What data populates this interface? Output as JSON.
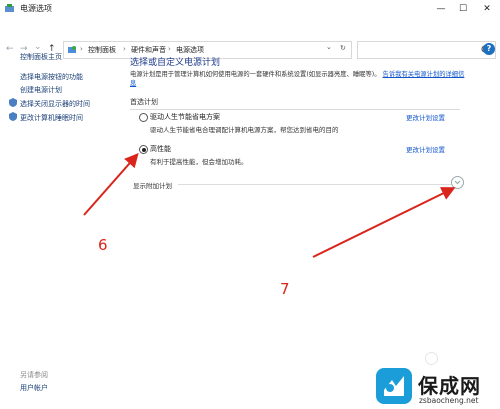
{
  "window": {
    "title": "电源选项",
    "minimize_glyph": "—",
    "maximize_glyph": "☐",
    "close_glyph": "✕"
  },
  "nav": {
    "back": "←",
    "forward": "→",
    "down": "⌄",
    "up": "↑"
  },
  "address": {
    "crumbs": [
      "控制面板",
      "硬件和声音",
      "电源选项"
    ],
    "separator": "›",
    "dropdown": "⌄",
    "refresh": "↻"
  },
  "search": {
    "placeholder": ""
  },
  "help": {
    "label": "?"
  },
  "sidebar": {
    "home": "控制面板主页",
    "links": [
      "选择电源按钮的功能",
      "创建电源计划",
      "选择关闭显示器的时间",
      "更改计算机睡眠时间"
    ],
    "see_also": "另请参阅",
    "user_accounts": "用户帐户"
  },
  "main": {
    "title": "选择或自定义电源计划",
    "description": "电源计划是用于管理计算机如何使用电源的一套硬件和系统设置(如显示器亮度、睡眠等)。",
    "desc_link": "告诉我有关电源计划的详细信息",
    "preferred_section": "首选计划",
    "plans": [
      {
        "name": "驱动人生节能省电方案",
        "desc": "驱动人生节能省电合理调配计算机电源方案，帮您达到省电的目的",
        "link": "更改计划设置",
        "selected": false
      },
      {
        "name": "高性能",
        "desc": "有利于提高性能，但会增加功耗。",
        "link": "更改计划设置",
        "selected": true
      }
    ],
    "show_more": "显示附加计划"
  },
  "annotations": {
    "label_6": "6",
    "label_7": "7",
    "color": "#d9251c"
  },
  "watermark": {
    "text": "保成网",
    "url": "zsbaocheng.net",
    "color": "#1a9dd9"
  }
}
